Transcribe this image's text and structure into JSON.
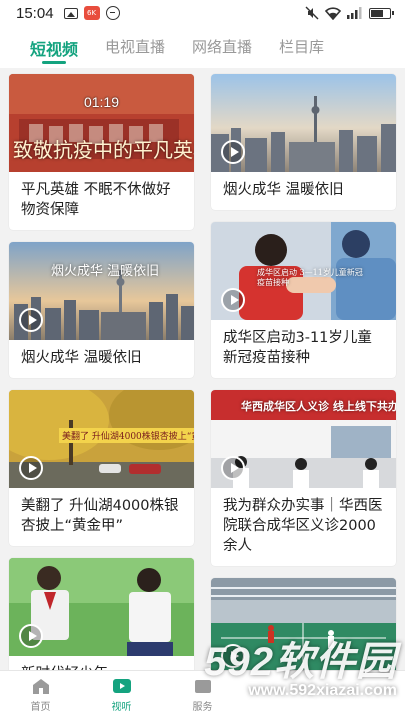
{
  "status_bar": {
    "time": "15:04",
    "app_badge": "6K"
  },
  "tabs": [
    {
      "label": "短视频",
      "active": true
    },
    {
      "label": "电视直播",
      "active": false
    },
    {
      "label": "网络直播",
      "active": false
    },
    {
      "label": "栏目库",
      "active": false
    }
  ],
  "feed": {
    "left": [
      {
        "title": "平凡英雄 不眠不休做好物资保障",
        "duration": "01:19",
        "thumb_text": "致敬抗疫中的平凡英雄"
      },
      {
        "title": "烟火成华 温暖依旧",
        "thumb_text": "烟火成华 温暖依旧"
      },
      {
        "title": "美翻了 升仙湖4000株银杏披上“黄金甲”",
        "thumb_text": "美翻了 升仙湖4000株银杏披上“黄金甲”"
      },
      {
        "title": "新时代好少年",
        "thumb_text": ""
      }
    ],
    "right": [
      {
        "title": "烟火成华 温暖依旧",
        "thumb_text": ""
      },
      {
        "title": "成华区启动3-11岁儿童新冠疫苗接种",
        "thumb_text": "成华区启动 3—11岁儿童新冠疫苗接种"
      },
      {
        "title": "我为群众办实事｜华西医院联合成华区义诊2000余人",
        "thumb_text": "华西成华区人义诊 线上线下共办实事"
      },
      {
        "title": "",
        "thumb_text": ""
      }
    ]
  },
  "bottom_nav": [
    {
      "label": "首页",
      "icon": "home-icon",
      "active": false
    },
    {
      "label": "视听",
      "icon": "video-icon",
      "active": true
    },
    {
      "label": "服务",
      "icon": "service-icon",
      "active": false
    },
    {
      "label": "",
      "icon": "",
      "active": false
    },
    {
      "label": "",
      "icon": "",
      "active": false
    }
  ],
  "watermark": {
    "brand": "592软件园",
    "url": "www.592xiazai.com"
  },
  "colors": {
    "accent": "#14a37f",
    "background": "#f2f2f2"
  }
}
